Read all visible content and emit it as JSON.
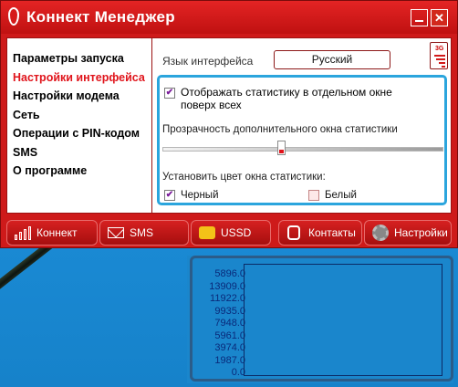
{
  "window": {
    "title": "Коннект Менеджер",
    "minimize_label": "_",
    "close_label": "✕"
  },
  "menu": {
    "items": [
      {
        "label": "Параметры запуска",
        "active": false
      },
      {
        "label": "Настройки интерфейса",
        "active": true
      },
      {
        "label": "Настройки модема",
        "active": false
      },
      {
        "label": "Сеть",
        "active": false
      },
      {
        "label": "Операции с PIN-кодом",
        "active": false
      },
      {
        "label": "SMS",
        "active": false
      },
      {
        "label": "О программе",
        "active": false
      }
    ]
  },
  "settings": {
    "language_label": "Язык интерфейса",
    "language_value": "Русский",
    "scroll_badge": "3G",
    "stats_checkbox": {
      "label": "Отображать статистику в отдельном окне поверх всех",
      "checked": true,
      "mark": "✔"
    },
    "transparency_label": "Прозрачность дополнительного окна статистики",
    "transparency_value": 0.42,
    "color_label": "Установить цвет окна статистики:",
    "color_black": {
      "label": "Черный",
      "checked": true,
      "mark": "✔"
    },
    "color_white": {
      "label": "Белый",
      "checked": false
    }
  },
  "toolbar": {
    "connect": "Коннект",
    "sms": "SMS",
    "ussd": "USSD",
    "contacts": "Контакты",
    "settings": "Настройки"
  },
  "stats": {
    "ticks": [
      "5896.0",
      "13909.0",
      "11922.0",
      "9935.0",
      "7948.0",
      "5961.0",
      "3974.0",
      "1987.0",
      "0.0"
    ]
  },
  "colors": {
    "brand_red": "#ce1a1a",
    "active_menu": "#e0141b",
    "highlight": "#2ba5dd"
  }
}
